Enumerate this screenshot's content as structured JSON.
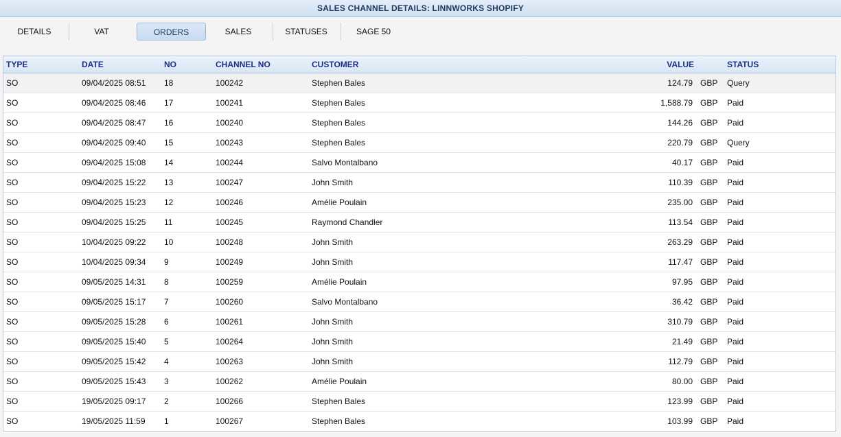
{
  "window": {
    "title": "SALES CHANNEL DETAILS: LINNWORKS SHOPIFY"
  },
  "tabs": [
    {
      "label": "DETAILS"
    },
    {
      "label": "VAT"
    },
    {
      "label": "ORDERS",
      "active": true
    },
    {
      "label": "SALES"
    },
    {
      "label": "STATUSES"
    },
    {
      "label": "SAGE 50"
    }
  ],
  "table": {
    "columns": {
      "type": "TYPE",
      "date": "DATE",
      "no": "NO",
      "channel_no": "CHANNEL NO",
      "customer": "CUSTOMER",
      "value": "VALUE",
      "status": "STATUS"
    },
    "currency": "GBP",
    "rows": [
      {
        "type": "SO",
        "date": "09/04/2025 08:51",
        "no": "18",
        "channel_no": "100242",
        "customer": "Stephen Bales",
        "value": "124.79",
        "currency": "GBP",
        "status": "Query"
      },
      {
        "type": "SO",
        "date": "09/04/2025 08:46",
        "no": "17",
        "channel_no": "100241",
        "customer": "Stephen Bales",
        "value": "1,588.79",
        "currency": "GBP",
        "status": "Paid"
      },
      {
        "type": "SO",
        "date": "09/04/2025 08:47",
        "no": "16",
        "channel_no": "100240",
        "customer": "Stephen Bales",
        "value": "144.26",
        "currency": "GBP",
        "status": "Paid"
      },
      {
        "type": "SO",
        "date": "09/04/2025 09:40",
        "no": "15",
        "channel_no": "100243",
        "customer": "Stephen Bales",
        "value": "220.79",
        "currency": "GBP",
        "status": "Query"
      },
      {
        "type": "SO",
        "date": "09/04/2025 15:08",
        "no": "14",
        "channel_no": "100244",
        "customer": "Salvo Montalbano",
        "value": "40.17",
        "currency": "GBP",
        "status": "Paid"
      },
      {
        "type": "SO",
        "date": "09/04/2025 15:22",
        "no": "13",
        "channel_no": "100247",
        "customer": "John Smith",
        "value": "110.39",
        "currency": "GBP",
        "status": "Paid"
      },
      {
        "type": "SO",
        "date": "09/04/2025 15:23",
        "no": "12",
        "channel_no": "100246",
        "customer": "Amélie Poulain",
        "value": "235.00",
        "currency": "GBP",
        "status": "Paid"
      },
      {
        "type": "SO",
        "date": "09/04/2025 15:25",
        "no": "11",
        "channel_no": "100245",
        "customer": "Raymond Chandler",
        "value": "113.54",
        "currency": "GBP",
        "status": "Paid"
      },
      {
        "type": "SO",
        "date": "10/04/2025 09:22",
        "no": "10",
        "channel_no": "100248",
        "customer": "John Smith",
        "value": "263.29",
        "currency": "GBP",
        "status": "Paid"
      },
      {
        "type": "SO",
        "date": "10/04/2025 09:34",
        "no": "9",
        "channel_no": "100249",
        "customer": "John Smith",
        "value": "117.47",
        "currency": "GBP",
        "status": "Paid"
      },
      {
        "type": "SO",
        "date": "09/05/2025 14:31",
        "no": "8",
        "channel_no": "100259",
        "customer": "Amélie Poulain",
        "value": "97.95",
        "currency": "GBP",
        "status": "Paid"
      },
      {
        "type": "SO",
        "date": "09/05/2025 15:17",
        "no": "7",
        "channel_no": "100260",
        "customer": "Salvo Montalbano",
        "value": "36.42",
        "currency": "GBP",
        "status": "Paid"
      },
      {
        "type": "SO",
        "date": "09/05/2025 15:28",
        "no": "6",
        "channel_no": "100261",
        "customer": "John Smith",
        "value": "310.79",
        "currency": "GBP",
        "status": "Paid"
      },
      {
        "type": "SO",
        "date": "09/05/2025 15:40",
        "no": "5",
        "channel_no": "100264",
        "customer": "John Smith",
        "value": "21.49",
        "currency": "GBP",
        "status": "Paid"
      },
      {
        "type": "SO",
        "date": "09/05/2025 15:42",
        "no": "4",
        "channel_no": "100263",
        "customer": "John Smith",
        "value": "112.79",
        "currency": "GBP",
        "status": "Paid"
      },
      {
        "type": "SO",
        "date": "09/05/2025 15:43",
        "no": "3",
        "channel_no": "100262",
        "customer": "Amélie Poulain",
        "value": "80.00",
        "currency": "GBP",
        "status": "Paid"
      },
      {
        "type": "SO",
        "date": "19/05/2025 09:17",
        "no": "2",
        "channel_no": "100266",
        "customer": "Stephen Bales",
        "value": "123.99",
        "currency": "GBP",
        "status": "Paid"
      },
      {
        "type": "SO",
        "date": "19/05/2025 11:59",
        "no": "1",
        "channel_no": "100267",
        "customer": "Stephen Bales",
        "value": "103.99",
        "currency": "GBP",
        "status": "Paid"
      }
    ]
  },
  "colors": {
    "header_text": "#1a2f8a",
    "title_text": "#1e3a5c",
    "active_tab_bg": "#c7dbf2",
    "selected_row_bg": "#f2f2f2"
  }
}
